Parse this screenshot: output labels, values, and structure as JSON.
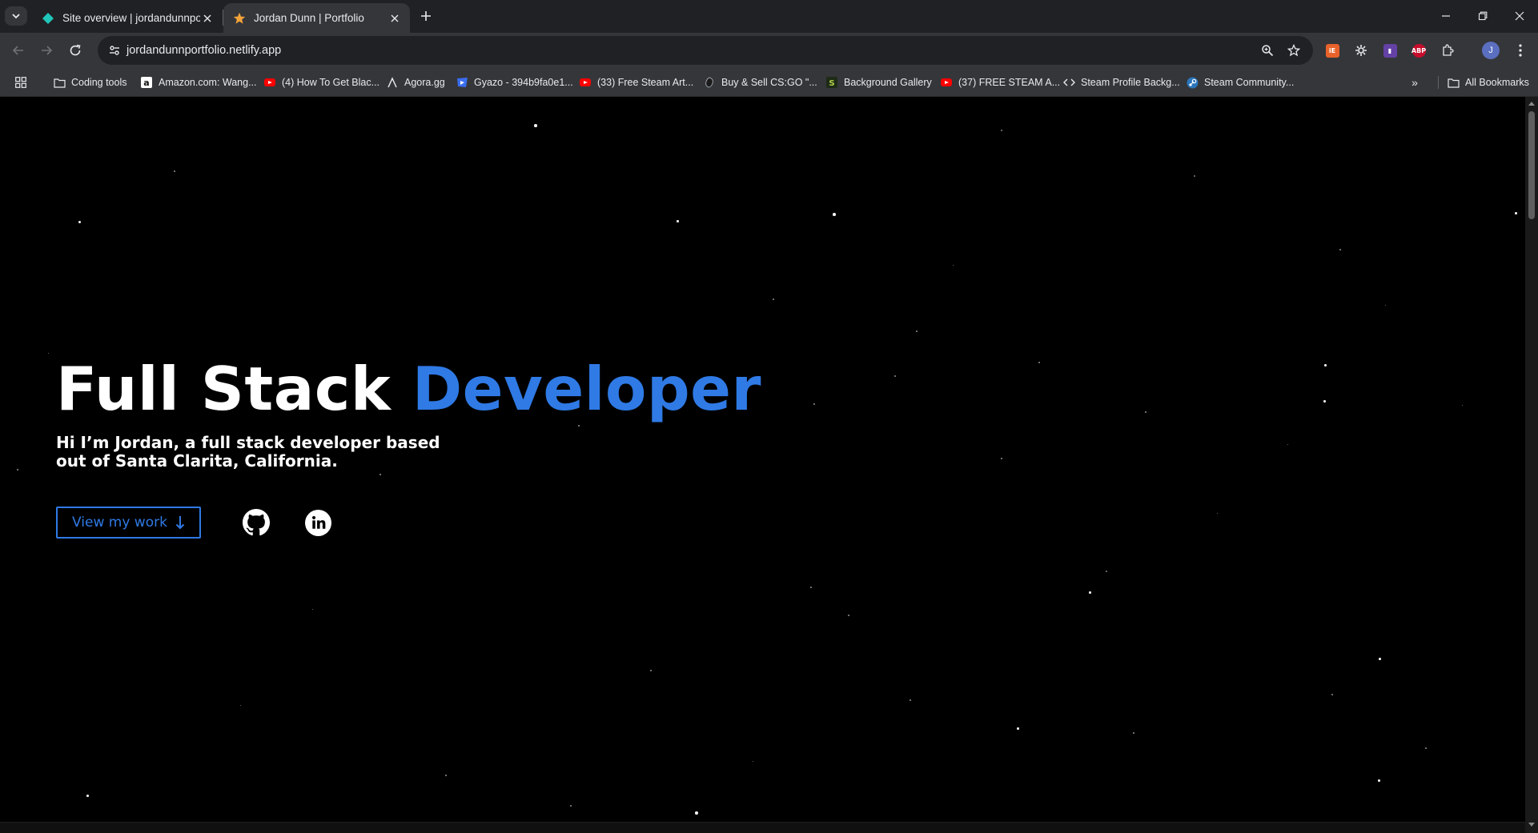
{
  "browser": {
    "tabs": [
      {
        "title": "Site overview | jordandunnportfolio",
        "favicon": "netlify-diamond-icon",
        "active": false
      },
      {
        "title": "Jordan Dunn | Portfolio",
        "favicon": "star-icon",
        "active": true
      }
    ],
    "url": "jordandunnportfolio.netlify.app",
    "profile_initial": "J",
    "extensions": [
      "ie-extension-icon",
      "gear-extension-icon",
      "twitch-extension-icon",
      "ABP",
      "puzzle-icon"
    ],
    "bookmarks": [
      {
        "label": "Coding tools",
        "icon": "folder-icon"
      },
      {
        "label": "Amazon.com: Wang...",
        "icon": "amazon-icon"
      },
      {
        "label": "(4) How To Get Blac...",
        "icon": "youtube-icon"
      },
      {
        "label": "Agora.gg",
        "icon": "agora-icon"
      },
      {
        "label": "Gyazo - 394b9fa0e1...",
        "icon": "gyazo-icon"
      },
      {
        "label": "(33) Free Steam Art...",
        "icon": "youtube-icon"
      },
      {
        "label": "Buy & Sell CS:GO \"...",
        "icon": "csgo-icon"
      },
      {
        "label": "Background Gallery",
        "icon": "s-icon"
      },
      {
        "label": "(37) FREE STEAM A...",
        "icon": "youtube-icon"
      },
      {
        "label": "Steam Profile Backg...",
        "icon": "code-icon"
      },
      {
        "label": "Steam Community...",
        "icon": "steam-icon"
      }
    ],
    "all_bookmarks": "All Bookmarks"
  },
  "hero": {
    "title_part1": "Full Stack ",
    "title_part2": "Developer",
    "subtitle": "Hi I’m Jordan, a full stack developer based out of Santa Clarita, California.",
    "cta_label": "View my work",
    "accent_color": "#2f7ae5",
    "socials": [
      "github-icon",
      "linkedin-icon"
    ]
  }
}
